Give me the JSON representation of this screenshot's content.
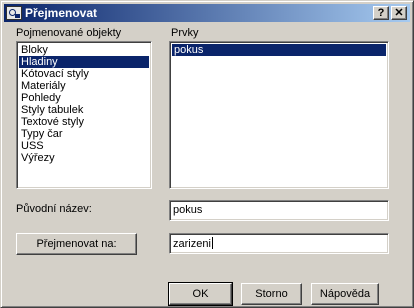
{
  "window": {
    "title": "Přejmenovat",
    "help_label": "?",
    "close_label": "✕"
  },
  "objects": {
    "label": "Pojmenované objekty",
    "items": [
      "Bloky",
      "Hladiny",
      "Kótovací styly",
      "Materiály",
      "Pohledy",
      "Styly tabulek",
      "Textové styly",
      "Typy čar",
      "USS",
      "Výřezy"
    ],
    "selected": "Hladiny"
  },
  "items_panel": {
    "label": "Prvky",
    "items": [
      "pokus"
    ],
    "selected": "pokus"
  },
  "old_name": {
    "label": "Původní název:",
    "value": "pokus"
  },
  "rename": {
    "button_label": "Přejmenovat na:",
    "value": "zarizeni"
  },
  "buttons": {
    "ok": "OK",
    "cancel": "Storno",
    "help": "Nápověda"
  },
  "icons": {
    "app": "autocad-app-icon",
    "help": "help-icon",
    "close": "close-icon"
  }
}
